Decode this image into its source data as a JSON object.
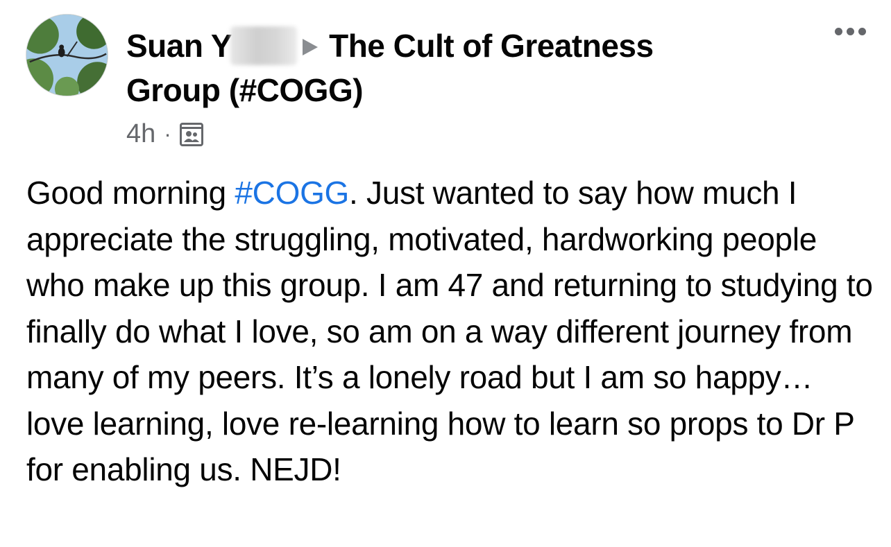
{
  "post": {
    "author_first": "Suan Y",
    "group_name": "The Cult of Greatness Group (#COGG)",
    "timestamp": "4h",
    "separator": "·",
    "audience_icon": "group-icon",
    "more_icon": "more-options-icon",
    "body_before_tag": "Good morning ",
    "hashtag": "#COGG",
    "body_after_tag": ". Just wanted to say how much I appreciate the struggling, motivated, hardworking people who make up this group. I am 47 and returning to studying to finally do what I love, so am on a way different journey from many of my peers. It’s a lonely road but I am so happy… love learning, love re-learning how to learn so props to Dr P for enabling us. NEJD!"
  },
  "colors": {
    "text": "#050505",
    "secondary": "#65676b",
    "link": "#1b74e4"
  }
}
